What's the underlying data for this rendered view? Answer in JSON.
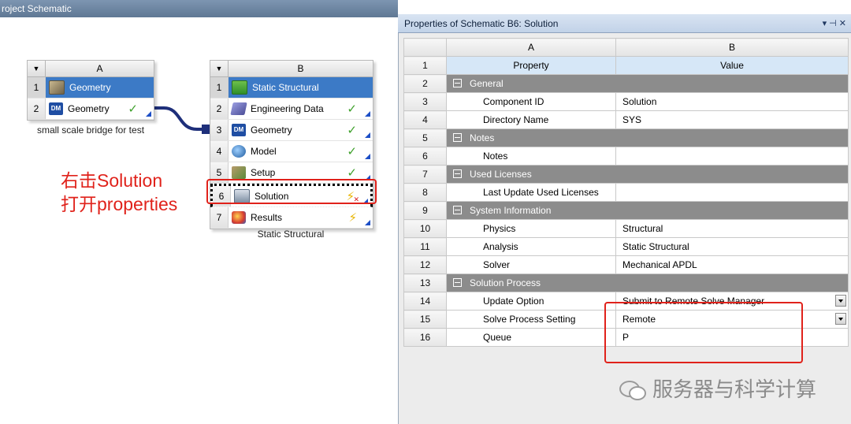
{
  "schematic": {
    "title": "roject Schematic",
    "system_a": {
      "letter": "A",
      "rows": [
        {
          "num": "1",
          "label": "Geometry",
          "icon": "geometry-icon",
          "status": "",
          "selected": true
        },
        {
          "num": "2",
          "label": "Geometry",
          "icon": "dm-icon",
          "status": "check"
        }
      ],
      "caption": "small scale bridge for test"
    },
    "system_b": {
      "letter": "B",
      "rows": [
        {
          "num": "1",
          "label": "Static Structural",
          "icon": "static-structural-icon",
          "status": "",
          "selected": true
        },
        {
          "num": "2",
          "label": "Engineering Data",
          "icon": "engineering-data-icon",
          "status": "check"
        },
        {
          "num": "3",
          "label": "Geometry",
          "icon": "dm-icon",
          "status": "check"
        },
        {
          "num": "4",
          "label": "Model",
          "icon": "model-icon",
          "status": "check"
        },
        {
          "num": "5",
          "label": "Setup",
          "icon": "setup-icon",
          "status": "check"
        },
        {
          "num": "6",
          "label": "Solution",
          "icon": "solution-icon",
          "status": "refresh-needed"
        },
        {
          "num": "7",
          "label": "Results",
          "icon": "results-icon",
          "status": "update"
        }
      ],
      "caption": "Static Structural"
    },
    "annotation": {
      "line1": "右击Solution",
      "line2": "打开properties"
    }
  },
  "properties": {
    "title": "Properties of Schematic B6: Solution",
    "window_controls": "▾ ⊣ ✕",
    "col_a": "A",
    "col_b": "B",
    "header": {
      "num": "1",
      "property": "Property",
      "value": "Value"
    },
    "rows": [
      {
        "num": "2",
        "group": "General"
      },
      {
        "num": "3",
        "property": "Component ID",
        "value": "Solution"
      },
      {
        "num": "4",
        "property": "Directory Name",
        "value": "SYS"
      },
      {
        "num": "5",
        "group": "Notes"
      },
      {
        "num": "6",
        "property": "Notes",
        "value": ""
      },
      {
        "num": "7",
        "group": "Used Licenses"
      },
      {
        "num": "8",
        "property": "Last Update Used Licenses",
        "value": ""
      },
      {
        "num": "9",
        "group": "System Information"
      },
      {
        "num": "10",
        "property": "Physics",
        "value": "Structural"
      },
      {
        "num": "11",
        "property": "Analysis",
        "value": "Static Structural"
      },
      {
        "num": "12",
        "property": "Solver",
        "value": "Mechanical APDL"
      },
      {
        "num": "13",
        "group": "Solution Process"
      },
      {
        "num": "14",
        "property": "Update Option",
        "value": "Submit to Remote Solve Manager",
        "dropdown": true
      },
      {
        "num": "15",
        "property": "Solve Process Setting",
        "value": "Remote",
        "dropdown": true
      },
      {
        "num": "16",
        "property": "Queue",
        "value": "P"
      }
    ]
  },
  "watermark": "服务器与科学计算",
  "colors": {
    "selection": "#3c7ac6",
    "annotation": "#e0221b",
    "group_row": "#8c8c8c",
    "check": "#3fa12c"
  }
}
